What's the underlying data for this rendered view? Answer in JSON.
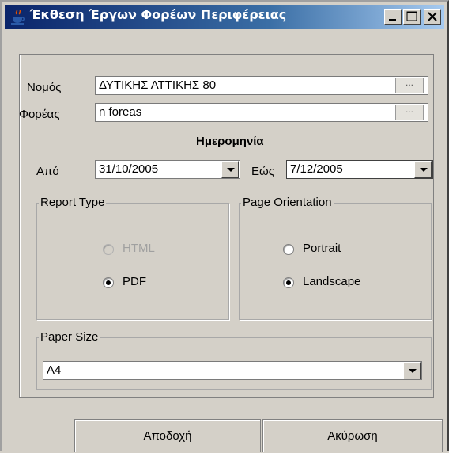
{
  "window": {
    "title": "Έκθεση Έργων Φορέων Περιφέρειας",
    "icon": "java-cup-icon"
  },
  "nomos": {
    "label": "Νομός",
    "value": "ΔΥΤΙΚΗΣ ΑΤΤΙΚΗΣ  80",
    "browse_label": "..."
  },
  "foreas": {
    "label": "Φορέας",
    "value": "n foreas",
    "browse_label": "..."
  },
  "date": {
    "heading": "Ημερομηνία",
    "from_label": "Από",
    "from_value": "31/10/2005",
    "to_label": "Εώς",
    "to_value": "7/12/2005"
  },
  "report_type": {
    "title": "Report Type",
    "options": [
      {
        "label": "HTML",
        "selected": false,
        "enabled": false
      },
      {
        "label": "PDF",
        "selected": true,
        "enabled": true
      }
    ]
  },
  "page_orientation": {
    "title": "Page Orientation",
    "options": [
      {
        "label": "Portrait",
        "selected": false,
        "enabled": true
      },
      {
        "label": "Landscape",
        "selected": true,
        "enabled": true
      }
    ]
  },
  "paper_size": {
    "title": "Paper Size",
    "value": "A4"
  },
  "buttons": {
    "ok": "Αποδοχή",
    "cancel": "Ακύρωση"
  }
}
